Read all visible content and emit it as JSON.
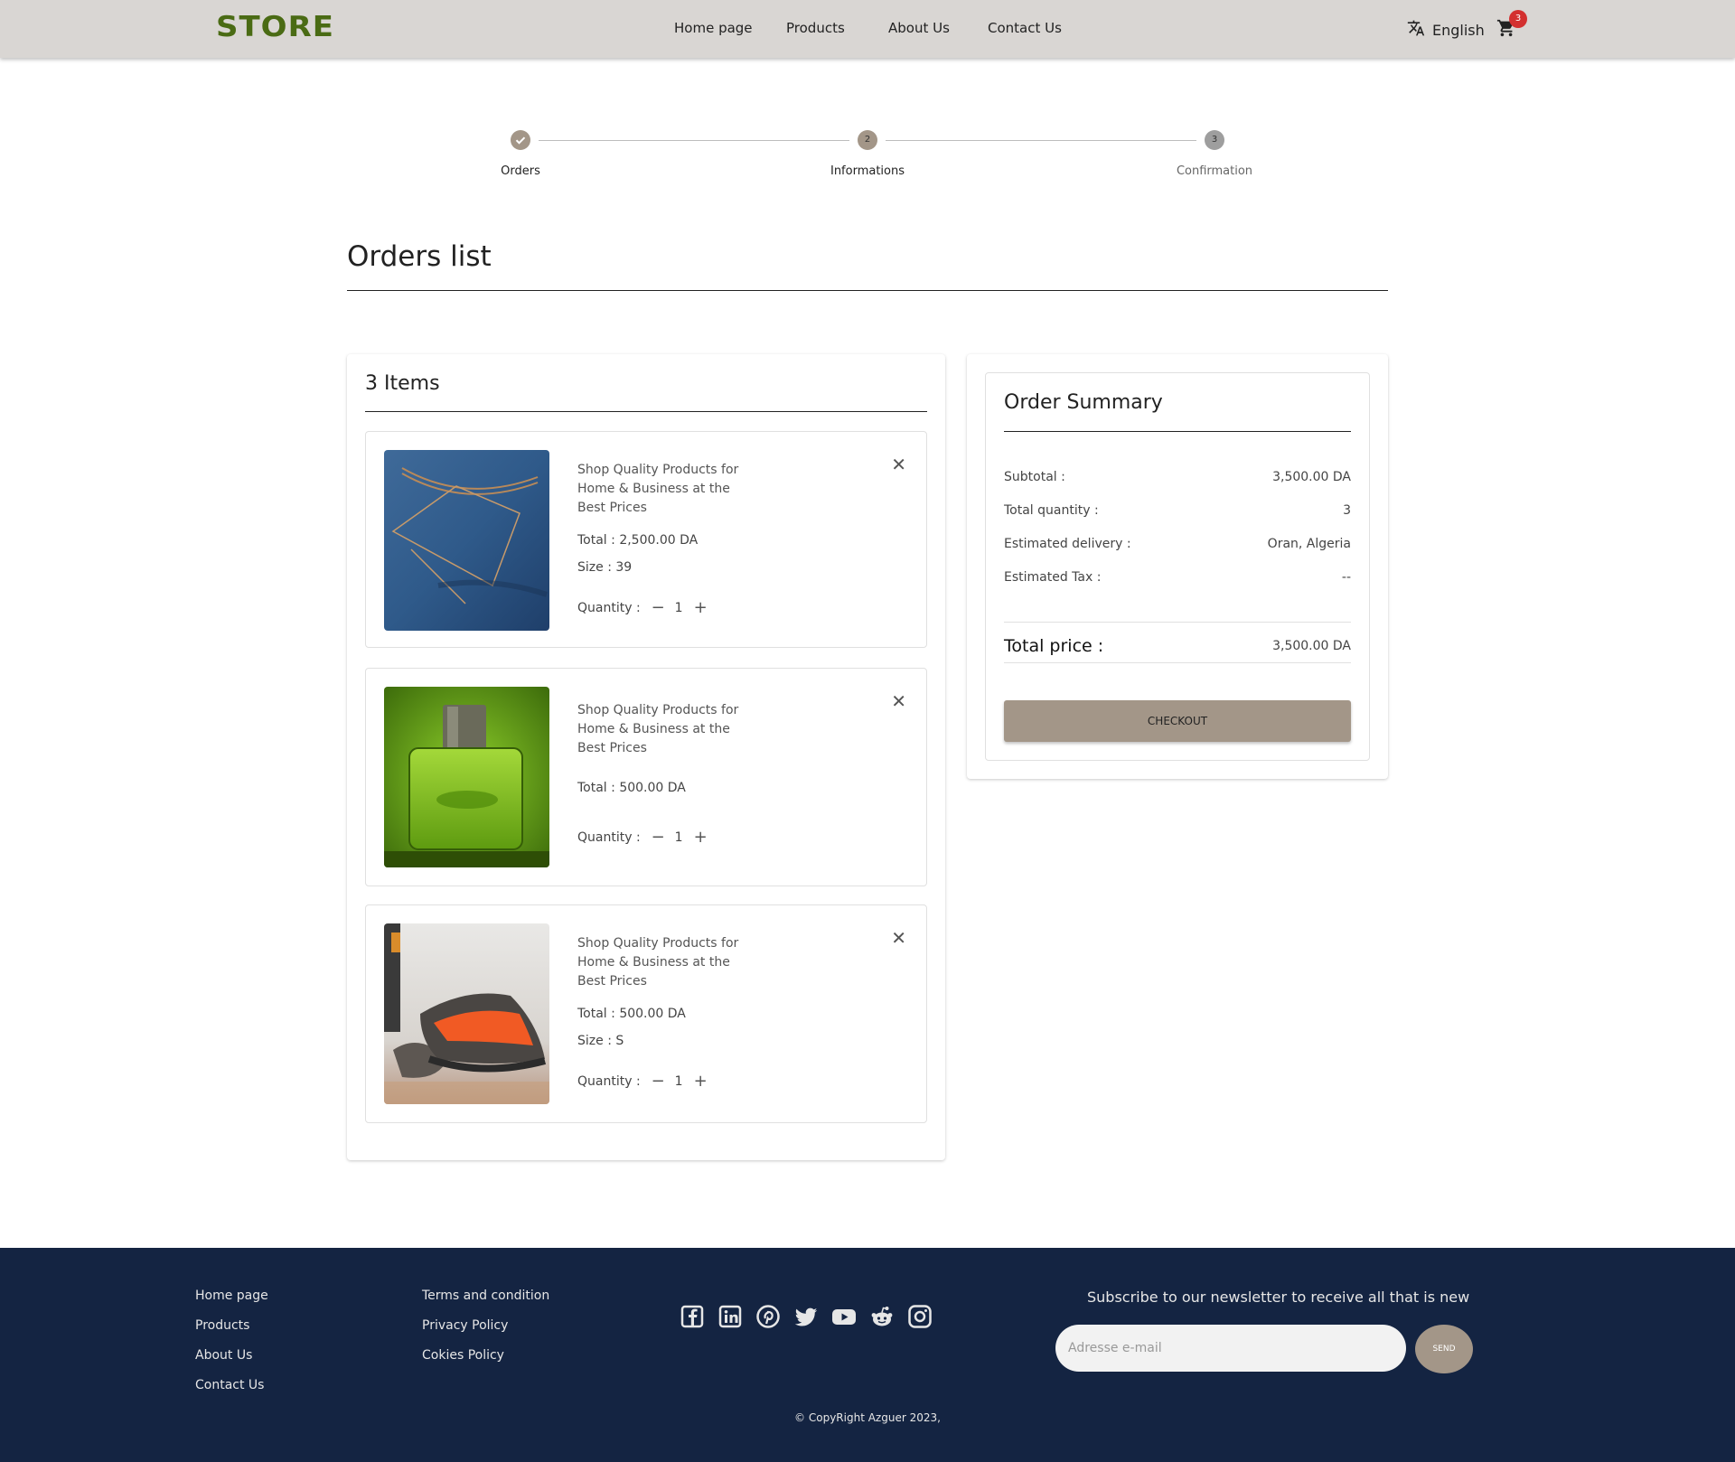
{
  "header": {
    "logo": "STORE",
    "nav": [
      "Home page",
      "Products",
      "About Us",
      "Contact Us"
    ],
    "language": "English",
    "cart_count": "3"
  },
  "stepper": {
    "steps": [
      {
        "number": "",
        "label": "Orders",
        "state": "completed"
      },
      {
        "number": "2",
        "label": "Informations",
        "state": "active"
      },
      {
        "number": "3",
        "label": "Confirmation",
        "state": "pending"
      }
    ]
  },
  "page": {
    "title": "Orders list"
  },
  "items_panel": {
    "title": "3 Items",
    "items": [
      {
        "name": "Shop Quality Products for Home & Business at the Best Prices",
        "total": "Total : 2,500.00 DA",
        "size": "Size : 39",
        "quantity_label": "Quantity :",
        "quantity": "1"
      },
      {
        "name": "Shop Quality Products for Home & Business at the Best Prices",
        "total": "Total : 500.00 DA",
        "size": "",
        "quantity_label": "Quantity :",
        "quantity": "1"
      },
      {
        "name": "Shop Quality Products for Home & Business at the Best Prices",
        "total": "Total : 500.00 DA",
        "size": "Size : S",
        "quantity_label": "Quantity :",
        "quantity": "1"
      }
    ]
  },
  "summary": {
    "title": "Order Summary",
    "rows": [
      {
        "label": "Subtotal :",
        "value": "3,500.00 DA"
      },
      {
        "label": "Total quantity :",
        "value": "3"
      },
      {
        "label": "Estimated delivery :",
        "value": "Oran, Algeria"
      },
      {
        "label": "Estimated Tax :",
        "value": "--"
      }
    ],
    "total_label": "Total price :",
    "total_value": "3,500.00 DA",
    "checkout_label": "CHECKOUT"
  },
  "footer": {
    "links_col1": [
      "Home page",
      "Products",
      "About Us",
      "Contact Us"
    ],
    "links_col2": [
      "Terms and condition",
      "Privacy Policy",
      "Cokies Policy"
    ],
    "social_icons": [
      "facebook-icon",
      "linkedin-icon",
      "pinterest-icon",
      "twitter-icon",
      "youtube-icon",
      "reddit-icon",
      "instagram-icon"
    ],
    "newsletter_text": "Subscribe to our newsletter to receive all that is new",
    "email_placeholder": "Adresse e-mail",
    "send_label": "SEND",
    "copyright": "© CopyRight Azguer 2023,"
  },
  "colors": {
    "header_bg": "#d9d6d3",
    "logo": "#4a6b14",
    "accent": "#a39688",
    "footer_bg": "#142442",
    "badge": "#d3302f"
  }
}
